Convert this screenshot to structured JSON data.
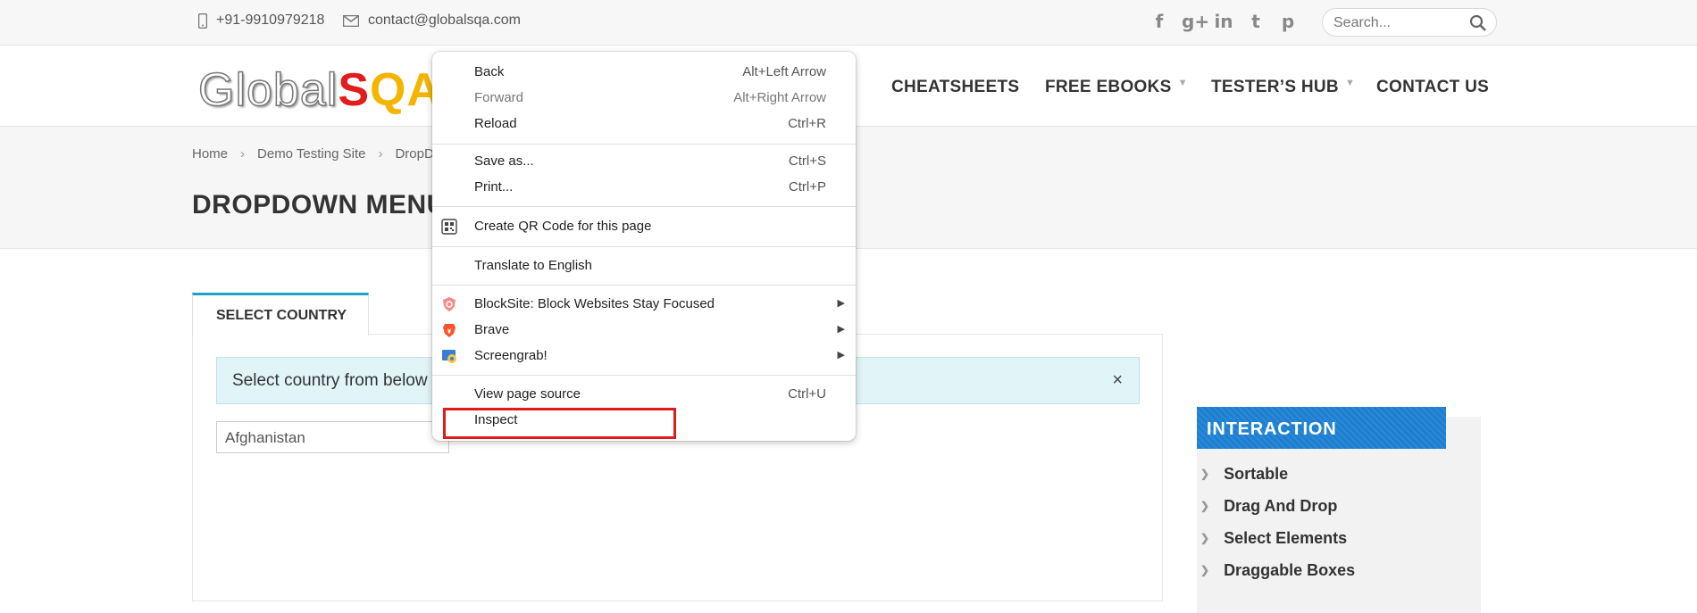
{
  "topbar": {
    "phone": "+91-9910979218",
    "email": "contact@globalsqa.com",
    "social_icons": [
      "facebook-icon",
      "google-plus-icon",
      "linkedin-icon",
      "twitter-icon",
      "pinterest-icon"
    ],
    "social_glyphs": [
      "f",
      "g+",
      "in",
      "t",
      "p"
    ],
    "search_placeholder": "Search..."
  },
  "header": {
    "logo_global": "Global",
    "logo_s": "S",
    "logo_qa": "QA",
    "nav": [
      {
        "label": "CHEATSHEETS",
        "has_caret": false
      },
      {
        "label": "FREE EBOOKS",
        "has_caret": true
      },
      {
        "label": "TESTER’S HUB",
        "has_caret": true
      },
      {
        "label": "CONTACT US",
        "has_caret": false
      }
    ]
  },
  "breadcrumb": [
    "Home",
    "Demo Testing Site",
    "DropDo"
  ],
  "page_title": "DROPDOWN MENU",
  "tab_label": "SELECT COUNTRY",
  "alert_text": "Select country from below",
  "alert_close": "×",
  "select_value": "Afghanistan",
  "sidebar": {
    "heading": "INTERACTION",
    "items": [
      "Sortable",
      "Drag And Drop",
      "Select Elements",
      "Draggable Boxes"
    ]
  },
  "context_menu": {
    "group1": [
      {
        "label": "Back",
        "shortcut": "Alt+Left Arrow",
        "disabled": false
      },
      {
        "label": "Forward",
        "shortcut": "Alt+Right Arrow",
        "disabled": true
      },
      {
        "label": "Reload",
        "shortcut": "Ctrl+R",
        "disabled": false
      }
    ],
    "group2": [
      {
        "label": "Save as...",
        "shortcut": "Ctrl+S"
      },
      {
        "label": "Print...",
        "shortcut": "Ctrl+P"
      }
    ],
    "qr": {
      "label": "Create QR Code for this page",
      "icon": "qr-code-icon"
    },
    "translate": {
      "label": "Translate to English"
    },
    "extensions": [
      {
        "label": "BlockSite: Block Websites  Stay Focused",
        "icon": "blocksite-icon"
      },
      {
        "label": "Brave",
        "icon": "brave-icon"
      },
      {
        "label": "Screengrab!",
        "icon": "screengrab-icon"
      }
    ],
    "group_last": [
      {
        "label": "View page source",
        "shortcut": "Ctrl+U"
      },
      {
        "label": "Inspect",
        "shortcut": ""
      }
    ]
  },
  "colors": {
    "accent_teal": "#1aa4c9",
    "sidebar_blue": "#1c7fd1",
    "highlight_red": "#e01b1b"
  }
}
